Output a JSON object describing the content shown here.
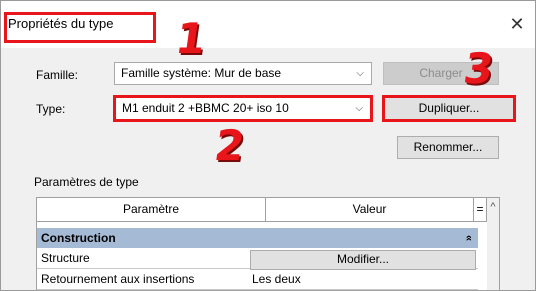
{
  "dialog": {
    "title": "Propriétés du type",
    "close_glyph": "✕"
  },
  "family": {
    "label": "Famille:",
    "value": "Famille système: Mur de base"
  },
  "type": {
    "label": "Type:",
    "value": "M1 enduit 2 +BBMC 20+ iso 10"
  },
  "buttons": {
    "load": "Charger",
    "duplicate": "Dupliquer...",
    "rename": "Renommer..."
  },
  "callouts": [
    "1",
    "2",
    "3"
  ],
  "type_params": {
    "section_label": "Paramètres de type",
    "columns": [
      "Paramètre",
      "Valeur",
      "="
    ],
    "group": "Construction",
    "rows": [
      {
        "param": "Structure",
        "value": "Modifier..."
      },
      {
        "param": "Retournement aux insertions",
        "value": "Les deux"
      }
    ]
  },
  "icons": {
    "chevron_down": "⌵",
    "collapse": "»",
    "scroll_up": "^"
  },
  "colors": {
    "annotation_red": "#e8151b",
    "group_row": "#a5bad4"
  }
}
